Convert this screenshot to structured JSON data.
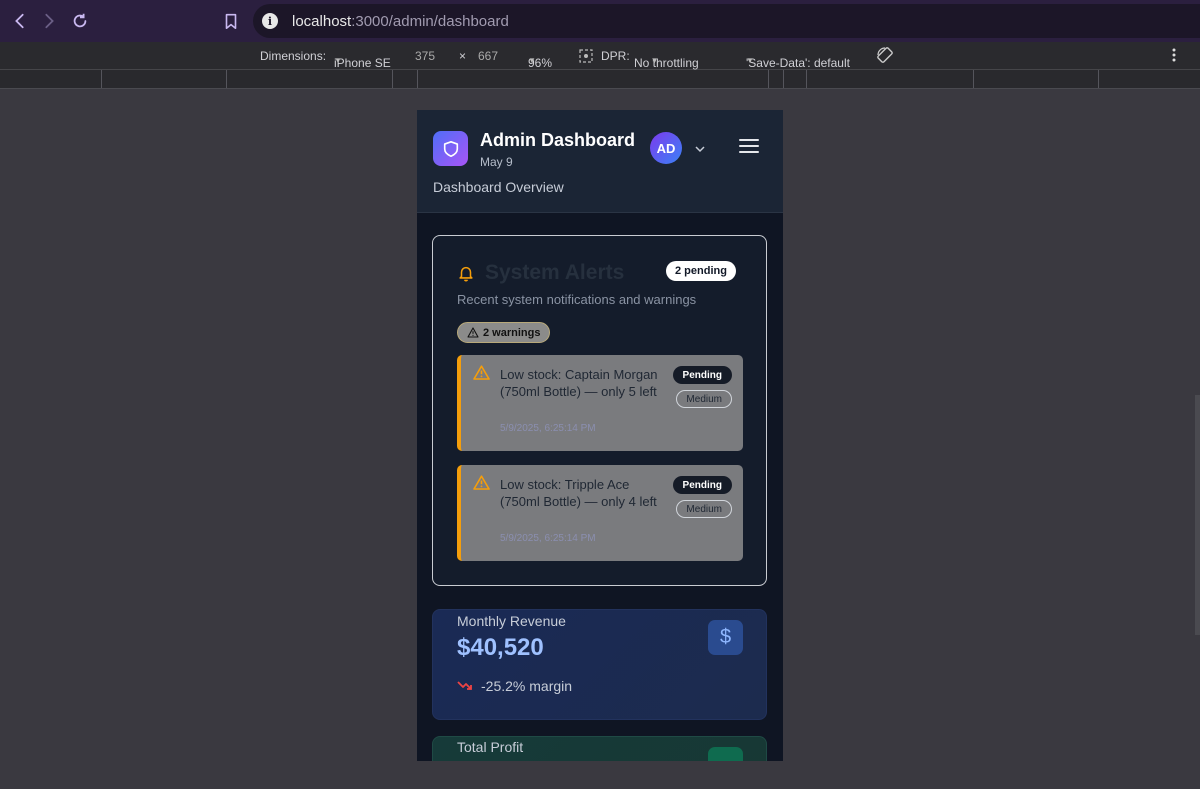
{
  "browser": {
    "url_host": "localhost",
    "url_path": ":3000/admin/dashboard"
  },
  "devtools": {
    "dimensions_label": "Dimensions:",
    "device": "iPhone SE",
    "width": "375",
    "times": "×",
    "height": "667",
    "zoom": "96%",
    "dpr_label": "DPR:",
    "throttling": "No throttling",
    "save_data": "'Save-Data': default"
  },
  "header": {
    "title": "Admin Dashboard",
    "date": "May 9",
    "avatar_initials": "AD",
    "subtitle": "Dashboard Overview"
  },
  "alerts": {
    "title": "System Alerts",
    "pending_badge": "2 pending",
    "description": "Recent system notifications and warnings",
    "warnings_badge": "2 warnings",
    "items": [
      {
        "text": "Low stock: Captain Morgan (750ml Bottle) — only 5 left",
        "time": "5/9/2025, 6:25:14 PM",
        "status": "Pending",
        "severity": "Medium"
      },
      {
        "text": "Low stock: Tripple Ace (750ml Bottle) — only 4 left",
        "time": "5/9/2025, 6:25:14 PM",
        "status": "Pending",
        "severity": "Medium"
      }
    ]
  },
  "revenue": {
    "label": "Monthly Revenue",
    "value": "$40,520",
    "icon": "$",
    "trend": "-25.2% margin"
  },
  "profit": {
    "label": "Total Profit"
  },
  "colors": {
    "accent_warning": "#f59e0b",
    "revenue_value": "#9fc1ff",
    "trend_down": "#ef4444"
  }
}
